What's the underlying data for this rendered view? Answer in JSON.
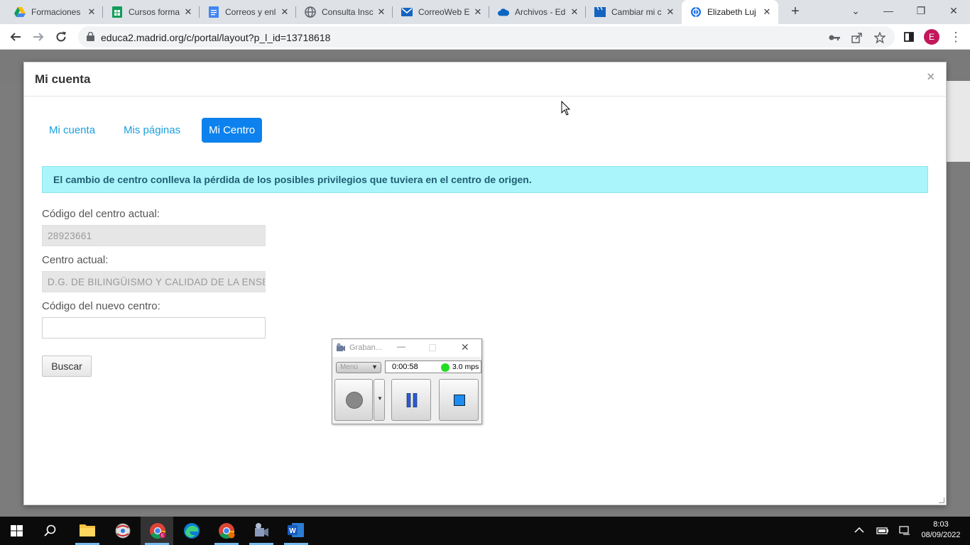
{
  "browser": {
    "tabs": [
      {
        "label": "Formaciones",
        "icon": "google-drive-icon"
      },
      {
        "label": "Cursos forma",
        "icon": "google-sheets-icon"
      },
      {
        "label": "Correos y enl",
        "icon": "google-docs-icon"
      },
      {
        "label": "Consulta Insc",
        "icon": "globe-icon"
      },
      {
        "label": "CorreoWeb E",
        "icon": "mail-icon"
      },
      {
        "label": "Archivos - Ed",
        "icon": "onedrive-icon"
      },
      {
        "label": "Cambiar mi c",
        "icon": "clapperboard-icon"
      },
      {
        "label": "Elizabeth Luj",
        "icon": "liferay-icon"
      }
    ],
    "url": "educa2.madrid.org/c/portal/layout?p_l_id=13718618",
    "profile_initial": "E"
  },
  "modal": {
    "title": "Mi cuenta",
    "close": "×",
    "tabs": [
      {
        "label": "Mi cuenta"
      },
      {
        "label": "Mis páginas"
      },
      {
        "label": "Mi Centro"
      }
    ],
    "alert": "El cambio de centro conlleva la pérdida de los posibles privilegios que tuviera en el centro de origen.",
    "codigo_actual_label": "Código del centro actual:",
    "codigo_actual_value": "28923661",
    "centro_actual_label": "Centro actual:",
    "centro_actual_value": "D.G. DE BILINGÜISMO Y CALIDAD DE LA ENSEÑANZA",
    "nuevo_codigo_label": "Código del nuevo centro:",
    "nuevo_codigo_value": "",
    "buscar_label": "Buscar"
  },
  "recorder": {
    "title": "Graban...",
    "menu_label": "Menú",
    "time": "0:00:58",
    "rate": "3.0 mps",
    "status_color": "#22dd22"
  },
  "taskbar": {
    "time": "8:03",
    "date": "08/09/2022",
    "apps": [
      "file-explorer-icon",
      "app-icon",
      "chrome-icon",
      "edge-icon",
      "chrome-profile-icon",
      "recorder-icon",
      "word-icon"
    ]
  },
  "colors": {
    "accent": "#0d82ee",
    "link": "#1a9fdf",
    "alert_bg": "#aaf5fb"
  }
}
